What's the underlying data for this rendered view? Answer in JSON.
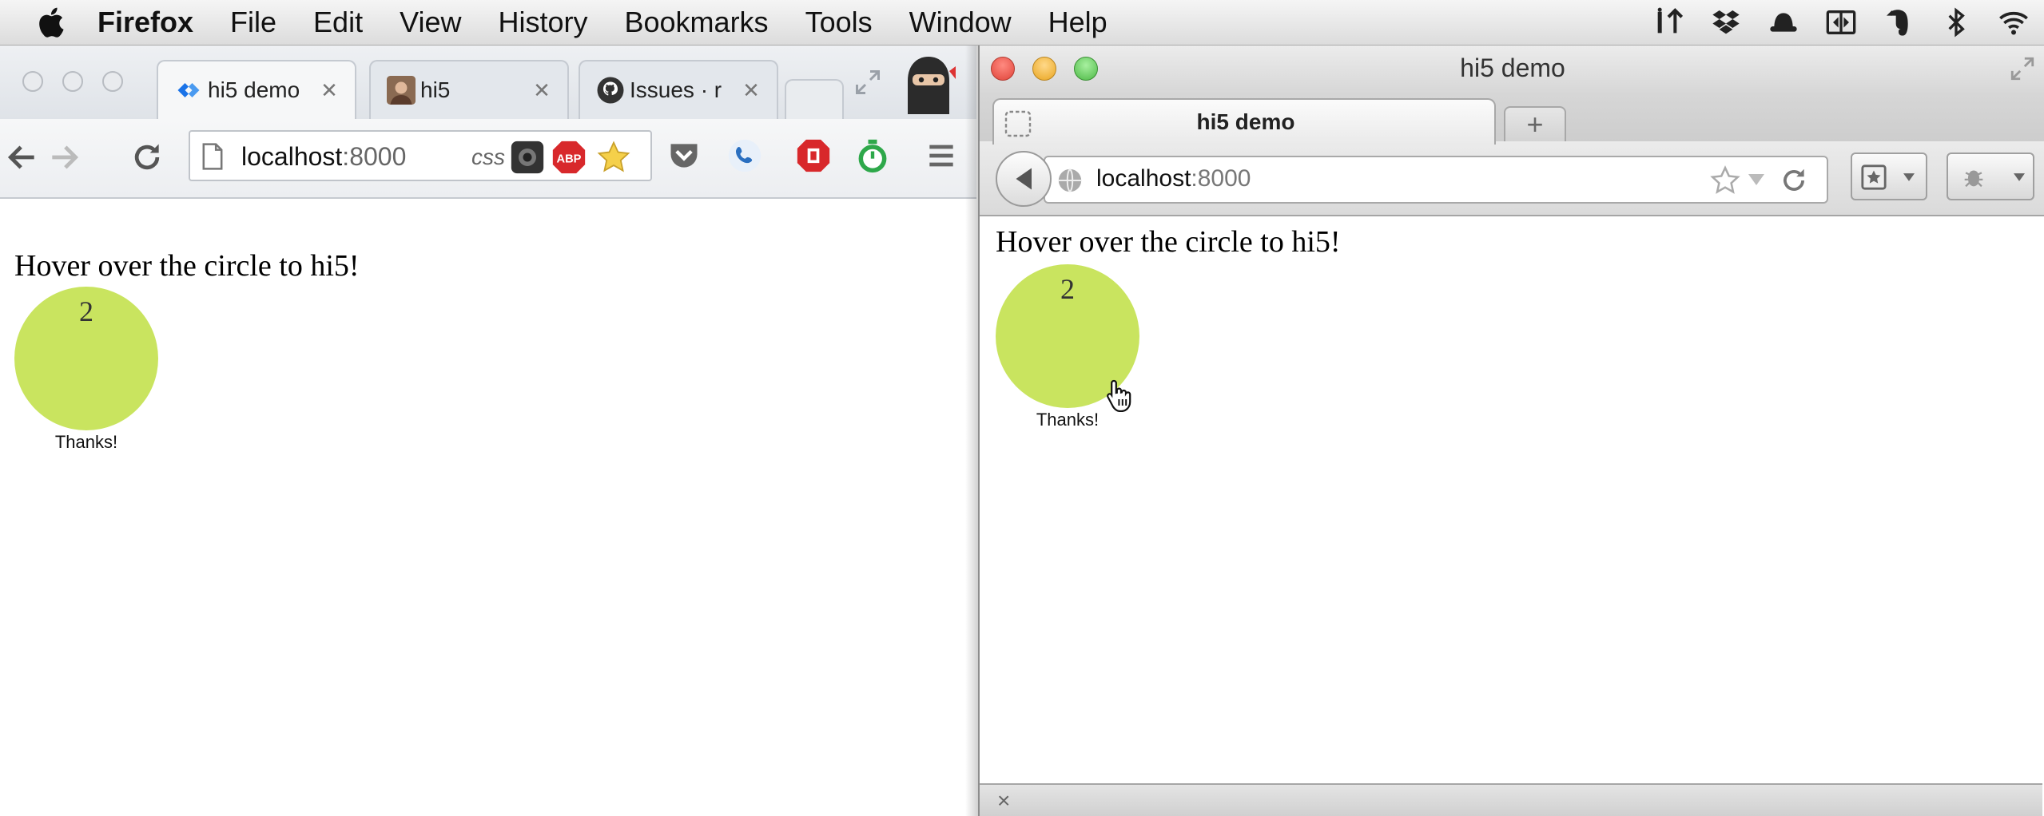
{
  "menubar": {
    "app_name": "Firefox",
    "items": [
      "File",
      "Edit",
      "View",
      "History",
      "Bookmarks",
      "Tools",
      "Window",
      "Help"
    ],
    "status_icons": [
      "iterm-icon",
      "dropbox-icon",
      "hat-icon",
      "screen-icon",
      "evernote-icon",
      "bluetooth-icon",
      "wifi-icon"
    ]
  },
  "chrome": {
    "tabs": [
      {
        "title": "hi5 demo",
        "icon": "diamond-icon",
        "active": true
      },
      {
        "title": "hi5",
        "icon": "avatar-icon",
        "active": false
      },
      {
        "title": "Issues · r",
        "icon": "github-icon",
        "active": false
      }
    ],
    "url_host": "localhost",
    "url_port": ":8000",
    "css_badge": "css",
    "page": {
      "heading": "Hover over the circle to hi5!",
      "count": "2",
      "thanks": "Thanks!"
    }
  },
  "firefox": {
    "window_title": "hi5 demo",
    "tab_title": "hi5 demo",
    "newtab_label": "+",
    "url_host": "localhost",
    "url_port": ":8000",
    "addon_close": "×",
    "page": {
      "heading": "Hover over the circle to hi5!",
      "count": "2",
      "thanks": "Thanks!"
    }
  },
  "colors": {
    "circle": "#c9e45f",
    "chrome_accent": "#1a73e8"
  }
}
